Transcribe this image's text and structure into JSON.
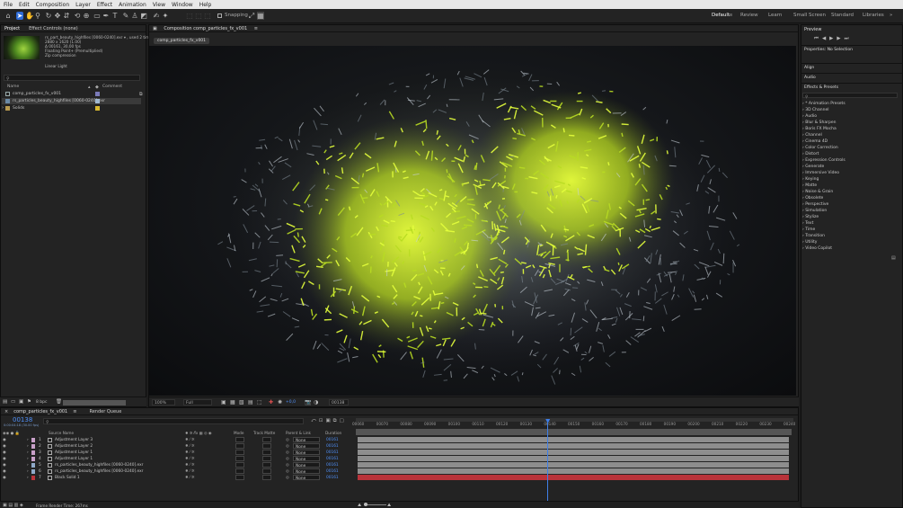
{
  "menu": [
    "File",
    "Edit",
    "Composition",
    "Layer",
    "Effect",
    "Animation",
    "View",
    "Window",
    "Help"
  ],
  "toolbar": {
    "snapping": "Snapping",
    "workspaces": [
      "Default",
      "Review",
      "Learn",
      "Small Screen",
      "Standard",
      "Libraries"
    ]
  },
  "project": {
    "tab": "Project",
    "effect_controls": "Effect Controls (none)",
    "file_name": "rs_part_beauty_highfiles [0060-0240].exr ▾ , used 2 times",
    "line2": "2880 x 1620 (1.00)",
    "line3": "Δ 00161, 30,00 fps",
    "line4": "Floating Point+ (Premultiplied)",
    "line5": "Zip compression",
    "line6": "Linear Light",
    "col_name": "Name",
    "col_comment": "Comment",
    "items": [
      "comp_particles_fx_v001",
      "rs_particles_beauty_highfiles [0060-0240].exr",
      "Solids"
    ],
    "bpc": "8 bpc"
  },
  "viewer": {
    "tab": "Composition comp_particles_fx_v001",
    "subtab": "comp_particles_fx_v001",
    "zoom": "100%",
    "resolution": "Full",
    "exposure": "+0,0",
    "timecode": "00138"
  },
  "timeline": {
    "tab": "comp_particles_fx_v001",
    "render_queue": "Render Queue",
    "current": "00138",
    "sub": "0:00:04:18 (30.00 fps)",
    "headers": {
      "source": "Source Name",
      "mode": "Mode",
      "trkmat": "Track Matte",
      "parent": "Parent & Link",
      "duration": "Duration"
    },
    "layers": [
      {
        "num": "1",
        "name": "Adjustment Layer 3",
        "mode": "",
        "parent": "None",
        "dur": "00161"
      },
      {
        "num": "2",
        "name": "Adjustment Layer 2",
        "mode": "",
        "parent": "None",
        "dur": "00161"
      },
      {
        "num": "3",
        "name": "Adjustment Layer 1",
        "mode": "",
        "parent": "None",
        "dur": "00161"
      },
      {
        "num": "4",
        "name": "Adjustment Layer 1",
        "mode": "",
        "parent": "None",
        "dur": "00161"
      },
      {
        "num": "5",
        "name": "rs_particles_beauty_highfiles [0060-0240].exr",
        "mode": "",
        "parent": "None",
        "dur": "00161"
      },
      {
        "num": "6",
        "name": "rs_particles_beauty_highfiles [0060-0240].exr",
        "mode": "",
        "parent": "None",
        "dur": "00161"
      },
      {
        "num": "7",
        "name": "Black Solid 1",
        "mode": "",
        "parent": "None",
        "dur": "00161"
      }
    ],
    "ruler": [
      "00060",
      "00070",
      "00080",
      "00090",
      "00100",
      "00110",
      "00120",
      "00130",
      "00140",
      "00150",
      "00160",
      "00170",
      "00180",
      "00190",
      "00200",
      "00210",
      "00220",
      "00230",
      "00240"
    ],
    "frame_render": "Frame Render Time: 267ms",
    "playhead": 0.44
  },
  "right": {
    "preview": "Preview",
    "properties": "Properties: No Selection",
    "align": "Align",
    "audio": "Audio",
    "effects": "Effects & Presets",
    "categories": [
      "* Animation Presets",
      "3D Channel",
      "Audio",
      "Blur & Sharpen",
      "Boris FX Mocha",
      "Channel",
      "Cinema 4D",
      "Color Correction",
      "Distort",
      "Expression Controls",
      "Generate",
      "Immersive Video",
      "Keying",
      "Matte",
      "Noise & Grain",
      "Obsolete",
      "Perspective",
      "Simulation",
      "Stylize",
      "Text",
      "Time",
      "Transition",
      "Utility",
      "Video Copilot"
    ]
  },
  "colors": {
    "accent": "#2d6bd6",
    "solid_red": "#b9333a",
    "bar_gray": "#8e8e8e"
  }
}
